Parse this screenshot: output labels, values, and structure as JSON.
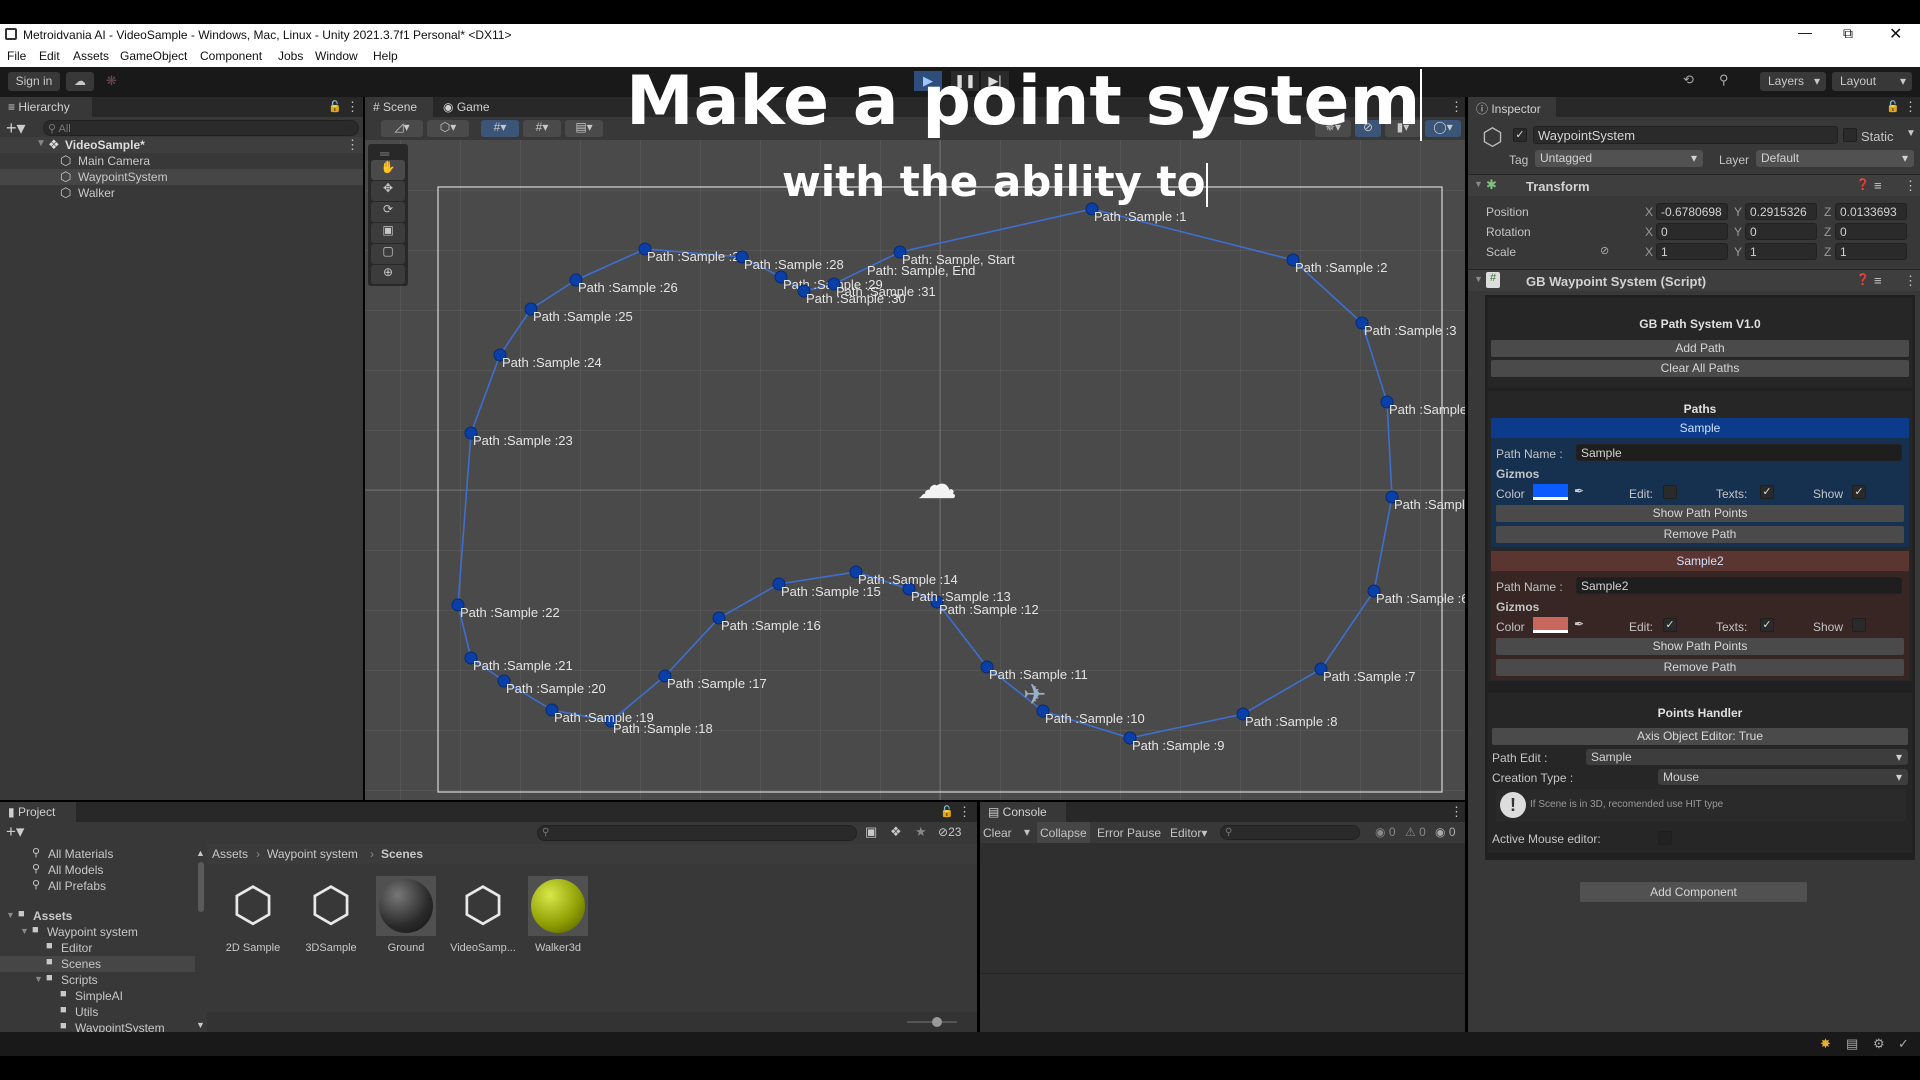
{
  "window": {
    "title": "Metroidvania AI - VideoSample - Windows, Mac, Linux - Unity 2021.3.7f1 Personal* <DX11>",
    "controls": [
      "minimize",
      "restore",
      "close"
    ]
  },
  "menu": [
    "File",
    "Edit",
    "Assets",
    "GameObject",
    "Component",
    "Jobs",
    "Window",
    "Help"
  ],
  "toolbar": {
    "sign_in": "Sign in",
    "layers": "Layers",
    "layout": "Layout"
  },
  "overlay": {
    "line1": "Make a point system",
    "line2": "with the ability to"
  },
  "hierarchy": {
    "tab": "Hierarchy",
    "search_placeholder": "All",
    "scene": "VideoSample*",
    "items": [
      "Main Camera",
      "WaypointSystem",
      "Walker"
    ]
  },
  "scene": {
    "tabs": [
      "Scene",
      "Game"
    ],
    "path_color": "#0a3fa8",
    "labels": [
      "Path: Sample, Start",
      "Path :Sample :1",
      "Path :Sample :2",
      "Path :Sample :3",
      "Path :Sample",
      "Path :Sample",
      "Path :Sample :6",
      "Path :Sample :7",
      "Path :Sample :8",
      "Path :Sample :9",
      "Path :Sample :10",
      "Path :Sample :11",
      "Path :Sample :12",
      "Path :Sample :13",
      "Path :Sample :14",
      "Path :Sample :15",
      "Path :Sample :16",
      "Path :Sample :17",
      "Path :Sample :18",
      "Path :Sample :19",
      "Path :Sample :20",
      "Path :Sample :21",
      "Path :Sample :22",
      "Path :Sample :23",
      "Path :Sample :24",
      "Path :Sample :25",
      "Path :Sample :26",
      "Path :Sample :27",
      "Path :Sample :28",
      "Path :Sample :29",
      "Path :Sample :30",
      "Path :Sample :31"
    ],
    "end_label": "Path: Sample, End"
  },
  "inspector": {
    "tab": "Inspector",
    "object_name": "WaypointSystem",
    "static": "Static",
    "tag_label": "Tag",
    "tag": "Untagged",
    "layer_label": "Layer",
    "layer": "Default",
    "transform": {
      "title": "Transform",
      "rows": [
        {
          "label": "Position",
          "x": "-0.6780698",
          "y": "0.2915326",
          "z": "0.0133693"
        },
        {
          "label": "Rotation",
          "x": "0",
          "y": "0",
          "z": "0"
        },
        {
          "label": "Scale",
          "x": "1",
          "y": "1",
          "z": "1"
        }
      ]
    },
    "script": {
      "title": "GB Waypoint System (Script)",
      "system_title": "GB Path System V1.0",
      "add_path": "Add Path",
      "clear_paths": "Clear All Paths",
      "paths_title": "Paths",
      "paths": [
        {
          "header": "Sample",
          "name_label": "Path Name :",
          "name": "Sample",
          "gizmos": "Gizmos",
          "color_label": "Color",
          "color": "#0a5cff",
          "edit_label": "Edit:",
          "edit": false,
          "texts_label": "Texts:",
          "texts": true,
          "show_label": "Show",
          "show": true,
          "show_points": "Show Path Points",
          "remove": "Remove Path",
          "header_bg": "#0d3b8c",
          "bg": "#16304f"
        },
        {
          "header": "Sample2",
          "name_label": "Path Name :",
          "name": "Sample2",
          "gizmos": "Gizmos",
          "color_label": "Color",
          "color": "#c8685c",
          "edit_label": "Edit:",
          "edit": true,
          "texts_label": "Texts:",
          "texts": true,
          "show_label": "Show",
          "show": false,
          "show_points": "Show Path Points",
          "remove": "Remove Path",
          "header_bg": "#5b3530",
          "bg": "#372624"
        }
      ],
      "points_handler": {
        "title": "Points Handler",
        "axis_button": "Axis Object Editor: True",
        "path_edit_label": "Path Edit :",
        "path_edit": "Sample",
        "creation_label": "Creation Type :",
        "creation": "Mouse",
        "info": "If Scene is in 3D, recomended use HIT type",
        "active_mouse_label": "Active Mouse editor:",
        "active_mouse": false
      }
    },
    "add_component": "Add Component"
  },
  "project": {
    "tab": "Project",
    "hidden_count": "23",
    "favorites": [
      "All Materials",
      "All Models",
      "All Prefabs"
    ],
    "tree": [
      {
        "label": "Assets",
        "depth": 0
      },
      {
        "label": "Waypoint system",
        "depth": 1
      },
      {
        "label": "Editor",
        "depth": 2
      },
      {
        "label": "Scenes",
        "depth": 2,
        "selected": true
      },
      {
        "label": "Scripts",
        "depth": 2
      },
      {
        "label": "SimpleAI",
        "depth": 3
      },
      {
        "label": "Utils",
        "depth": 3
      },
      {
        "label": "WaypointSystem",
        "depth": 3
      }
    ],
    "breadcrumb": [
      "Assets",
      "Waypoint system",
      "Scenes"
    ],
    "assets": [
      {
        "label": "2D Sample",
        "icon": "unity-scene-icon"
      },
      {
        "label": "3DSample",
        "icon": "unity-scene-icon"
      },
      {
        "label": "Ground",
        "icon": "dark-material-sphere"
      },
      {
        "label": "VideoSamp...",
        "icon": "unity-scene-icon"
      },
      {
        "label": "Walker3d",
        "icon": "yellow-material-sphere"
      }
    ]
  },
  "console": {
    "tab": "Console",
    "clear": "Clear",
    "collapse": "Collapse",
    "error_pause": "Error Pause",
    "editor": "Editor",
    "logs": "0",
    "warnings": "0",
    "errors": "0"
  }
}
